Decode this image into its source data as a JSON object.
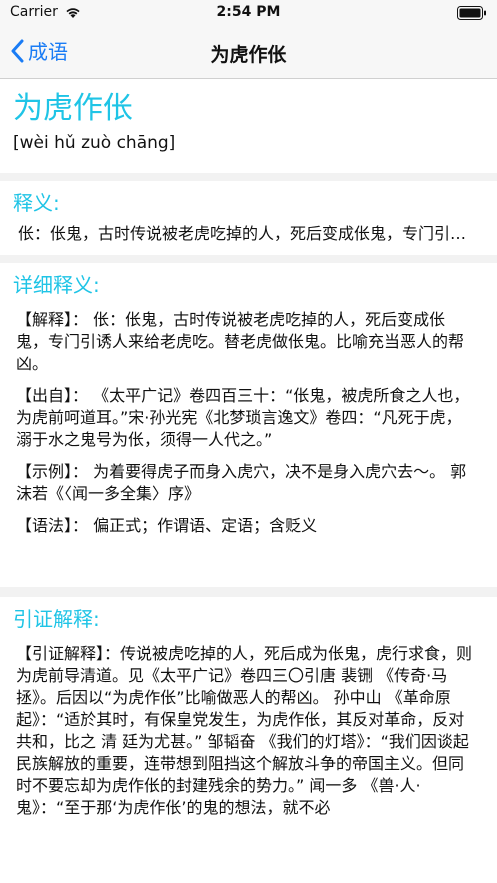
{
  "status_bar": {
    "carrier": "Carrier",
    "time": "2:54 PM"
  },
  "nav": {
    "back_label": "成语",
    "title": "为虎作伥"
  },
  "idiom": {
    "title": "为虎作伥",
    "pinyin": "[wèi hǔ zuò chāng]"
  },
  "brief": {
    "heading": "释义:",
    "text": "伥：伥鬼，古时传说被老虎吃掉的人，死后变成伥鬼，专门引诱人来给老虎吃。"
  },
  "detail": {
    "heading": "详细释义:",
    "paragraphs": [
      "【解释】： 伥：伥鬼，古时传说被老虎吃掉的人，死后变成伥鬼，专门引诱人来给老虎吃。替老虎做伥鬼。比喻充当恶人的帮凶。",
      "【出自】： 《太平广记》卷四百三十：“伥鬼，被虎所食之人也，为虎前呵道耳。”宋·孙光宪《北梦琐言逸文》卷四：“凡死于虎，溺于水之鬼号为伥，须得一人代之。”",
      "【示例】： 为着要得虎子而身入虎穴，决不是身入虎穴去～。 郭沫若《〈闻一多全集〉序》",
      "【语法】： 偏正式；作谓语、定语；含贬义"
    ]
  },
  "citation": {
    "heading": "引证解释:",
    "text": "【引证解释】：传说被虎吃掉的人，死后成为伥鬼，虎行求食，则为虎前导清道。见《太平广记》卷四三〇引唐 裴铏 《传奇·马拯》。后因以“为虎作伥”比喻做恶人的帮凶。 孙中山 《革命原起》：“适於其时，有保皇党发生，为虎作伥，其反对革命，反对共和，比之 清 廷为尤甚。” 邹韬奋 《我们的灯塔》：“我们因谈起民族解放的重要，连带想到阻挡这个解放斗争的帝国主义。但同时不要忘却为虎作伥的封建残余的势力。” 闻一多 《兽·人·鬼》：“至于那‘为虎作伥’的鬼的想法，就不必"
  },
  "colors": {
    "accent": "#1fc4e6",
    "link": "#1a7cf5"
  }
}
